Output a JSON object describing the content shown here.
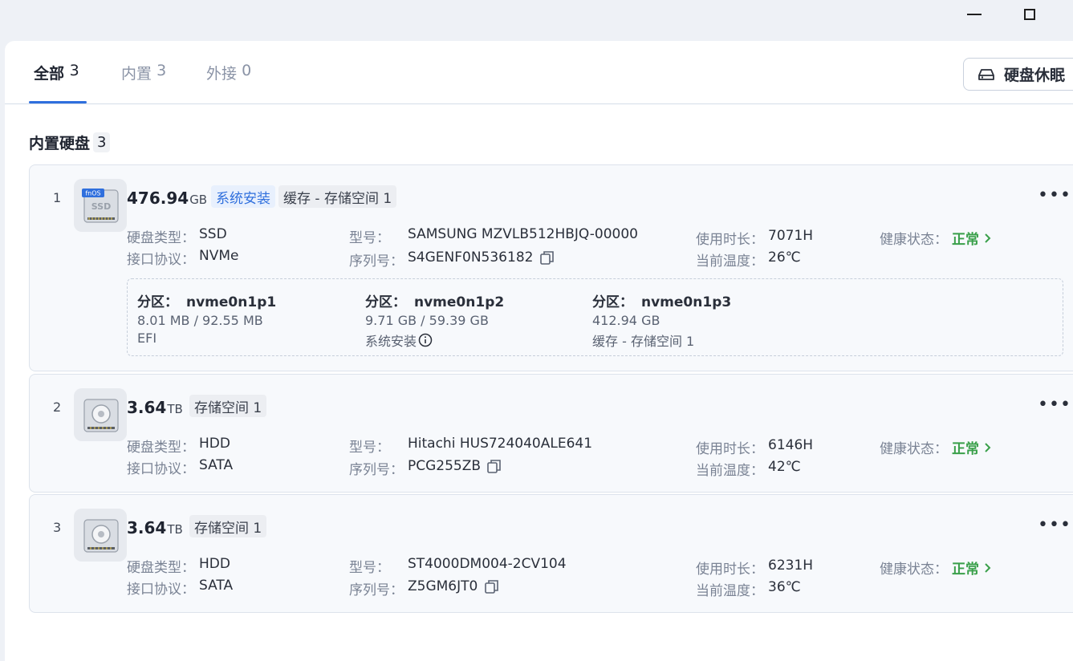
{
  "tabs": [
    {
      "label": "全部",
      "count": "3"
    },
    {
      "label": "内置",
      "count": "3"
    },
    {
      "label": "外接",
      "count": "0"
    }
  ],
  "toolbar": {
    "sleep_label": "硬盘休眠"
  },
  "section": {
    "title": "内置硬盘",
    "count": "3"
  },
  "labels": {
    "disk_type": "硬盘类型：",
    "interface": "接口协议：",
    "model": "型号：",
    "serial": "序列号：",
    "usage": "使用时长：",
    "temp": "当前温度：",
    "health": "健康状态：",
    "partition": "分区："
  },
  "disks": [
    {
      "index": "1",
      "capacity": "476.94",
      "unit": "GB",
      "tags": [
        "系统安装",
        "缓存 - 存储空间 1"
      ],
      "type": "SSD",
      "interface": "NVMe",
      "model": "SAMSUNG MZVLB512HBJQ-00000",
      "serial": "S4GENF0N536182",
      "usage": "7071H",
      "temp": "26℃",
      "health": "正常",
      "icon_badge": "fnOS",
      "icon_text": "SSD",
      "partitions": [
        {
          "name": "nvme0n1p1",
          "size": "8.01 MB / 92.55 MB",
          "usage": "EFI"
        },
        {
          "name": "nvme0n1p2",
          "size": "9.71 GB / 59.39 GB",
          "usage": "系统安装"
        },
        {
          "name": "nvme0n1p3",
          "size": "412.94 GB",
          "usage": "缓存 - 存储空间 1"
        }
      ]
    },
    {
      "index": "2",
      "capacity": "3.64",
      "unit": "TB",
      "tags": [
        "存储空间 1"
      ],
      "type": "HDD",
      "interface": "SATA",
      "model": "Hitachi HUS724040ALE641",
      "serial": "PCG255ZB",
      "usage": "6146H",
      "temp": "42℃",
      "health": "正常"
    },
    {
      "index": "3",
      "capacity": "3.64",
      "unit": "TB",
      "tags": [
        "存储空间 1"
      ],
      "type": "HDD",
      "interface": "SATA",
      "model": "ST4000DM004-2CV104",
      "serial": "Z5GM6JT0",
      "usage": "6231H",
      "temp": "36℃",
      "health": "正常"
    }
  ],
  "colors": {
    "accent": "#2f6fdd",
    "healthy": "#3aa04a"
  }
}
